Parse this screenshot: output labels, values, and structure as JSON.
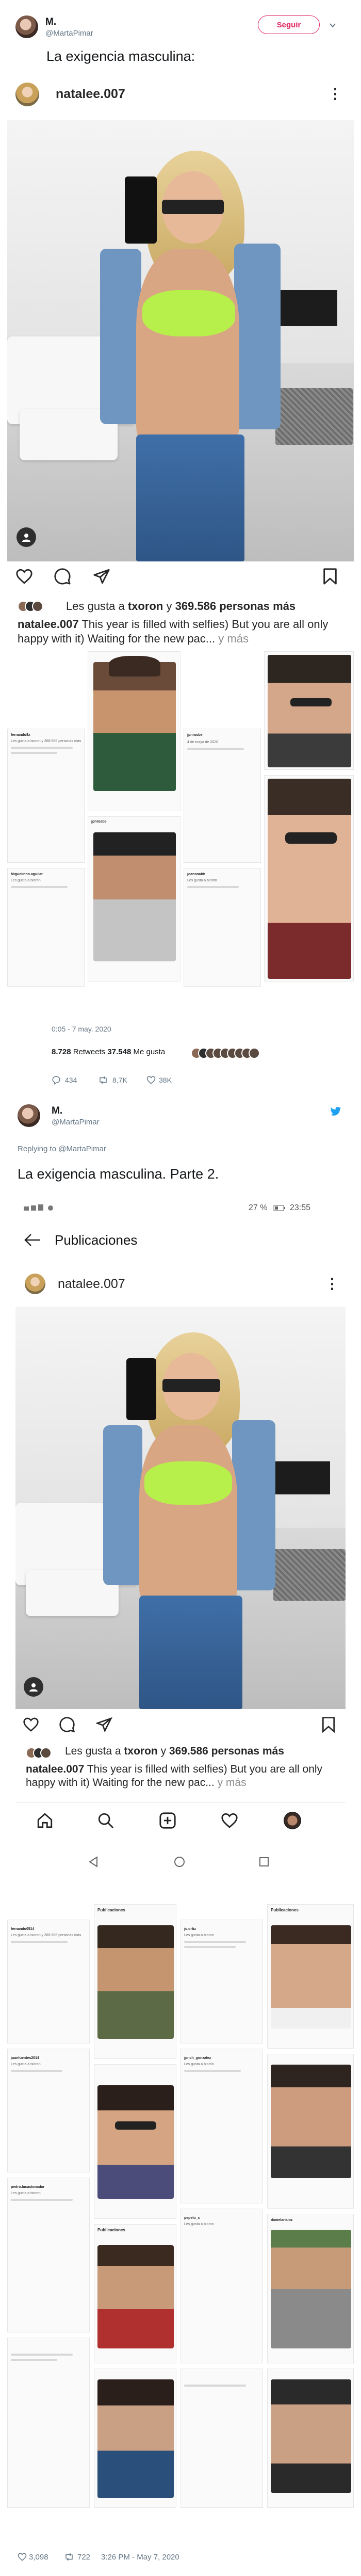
{
  "tweet1": {
    "name": "M.",
    "handle": "@MartaPimar",
    "follow_label": "Seguir",
    "text": "La exigencia masculina:"
  },
  "instagram1": {
    "username": "natalee.007",
    "likes_prefix": "Les gusta a ",
    "likes_user": "txoron",
    "likes_mid": " y ",
    "likes_count": "369.586 personas más",
    "caption_user": "natalee.007",
    "caption_text": " This year is filled with selfies) But you are all only happy with it) Waiting for the new pac...",
    "caption_more": " y más"
  },
  "collage1": {
    "cells": [
      {
        "name": "fernando8x",
        "text": "Les gusta a txoron y 369.586 personas más"
      },
      {
        "name": "jpnrosbe",
        "text": "Les gusta a txoron y 369.586 personas más"
      },
      {
        "name": "jpnrosbe",
        "text": "4 de mayo de 2020"
      },
      {
        "name": "Miguelinho.aguilar",
        "text": "Les gusta a txoron"
      },
      {
        "name": "joansnahh",
        "text": "Les gusta a txoron"
      }
    ],
    "date_labels": [
      "1 día",
      "4 de mayo de 2020"
    ]
  },
  "tweet1_footer": {
    "timestamp": "0:05 - 7 may. 2020",
    "retweets_count": "8.728",
    "retweets_label": " Retweets ",
    "likes_count": "37.548",
    "likes_label": " Me gusta",
    "replies": "434",
    "rts": "8,7K",
    "favs": "38K"
  },
  "tweet2": {
    "name": "M.",
    "handle": "@MartaPimar",
    "reply_to": "Replying to @MartaPimar",
    "text": "La exigencia masculina. Parte 2."
  },
  "android": {
    "battery": "27 %",
    "time": "23:55",
    "screen_title": "Publicaciones"
  },
  "instagram2": {
    "username": "natalee.007",
    "likes_prefix": "Les gusta a ",
    "likes_user": "txoron",
    "likes_mid": " y ",
    "likes_count": "369.586 personas más",
    "caption_user": "natalee.007",
    "caption_text": " This year is filled with selfies) But you are all only happy with it) Waiting for the new pac...",
    "caption_more": " y más"
  },
  "collage2": {
    "header": "Publicaciones",
    "cells": [
      {
        "name": "fernando0514",
        "text": "Les gusta a txoron y 369.586 personas más"
      },
      {
        "name": "jo.ortiz",
        "text": "Les gusta a txoron"
      },
      {
        "name": "juanfuentes2014",
        "text": "Les gusta a txoron"
      },
      {
        "name": "jpnch_gonzalez",
        "text": "Les gusta a txoron"
      },
      {
        "name": "pedro.lucastonador",
        "text": "Les gusta a txoron"
      },
      {
        "name": "pepelu_x",
        "text": "Les gusta a txoron"
      },
      {
        "name": "danielarianiz",
        "text": "Les gusta a txoron"
      }
    ]
  },
  "tweet2_footer": {
    "likes": "3,098",
    "retweets": "722",
    "time": "3:26 PM - May 7, 2020"
  },
  "colors": {
    "twitter_pink": "#e0245e",
    "twitter_blue": "#1da1f2",
    "ig_text": "#262626",
    "muted": "#657786"
  }
}
